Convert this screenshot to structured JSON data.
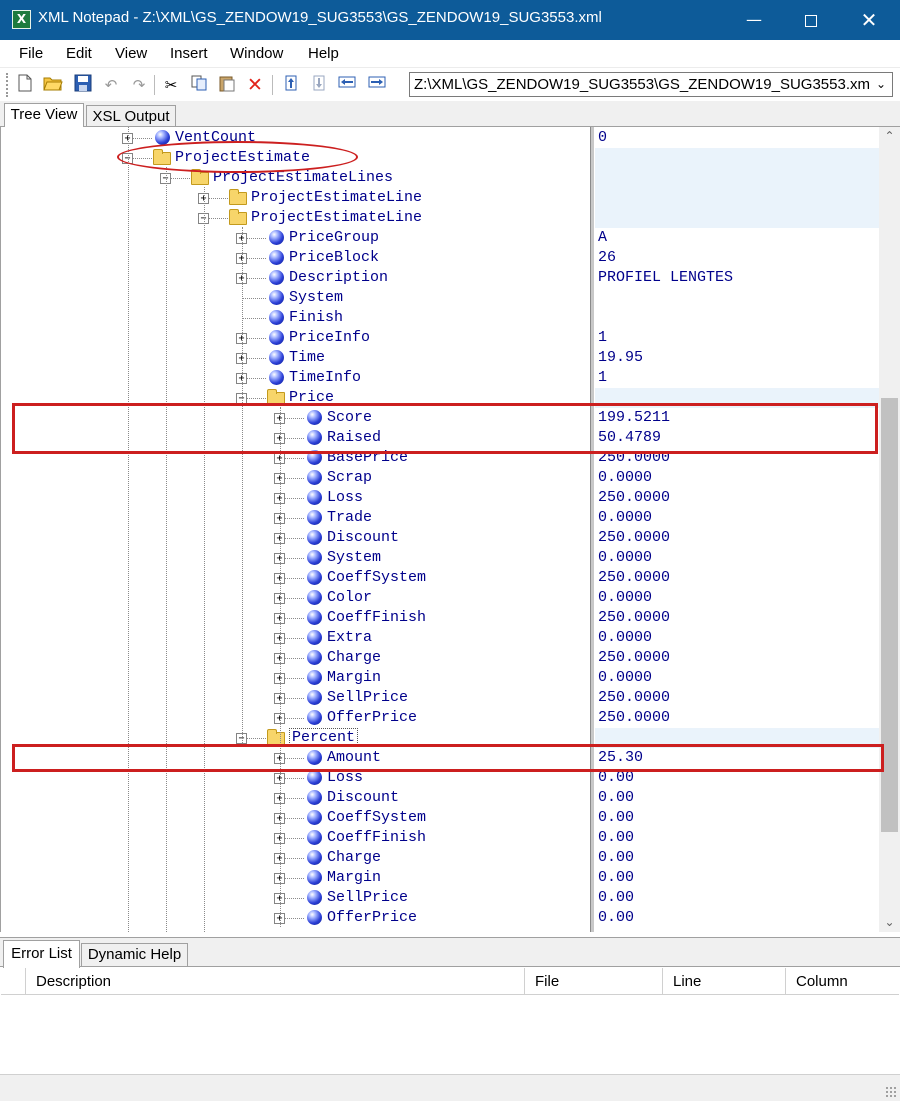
{
  "window": {
    "title": "XML Notepad - Z:\\XML\\GS_ZENDOW19_SUG3553\\GS_ZENDOW19_SUG3553.xml",
    "app_icon_letter": "X"
  },
  "menu": [
    "File",
    "Edit",
    "View",
    "Insert",
    "Window",
    "Help"
  ],
  "toolbar": {
    "icons": [
      "new-file-icon",
      "open-folder-icon",
      "save-icon",
      "undo-icon",
      "redo-icon",
      "cut-icon",
      "copy-icon",
      "paste-icon",
      "delete-icon",
      "nudge-up-icon",
      "nudge-down-icon",
      "nudge-left-icon",
      "nudge-right-icon"
    ],
    "path_value": "Z:\\XML\\GS_ZENDOW19_SUG3553\\GS_ZENDOW19_SUG3553.xml"
  },
  "tabs_top": [
    "Tree View",
    "XSL Output"
  ],
  "tree": [
    {
      "label": "VentCount",
      "value": "0"
    },
    {
      "label": "ProjectEstimate",
      "value": ""
    },
    {
      "label": "ProjectEstimateLines",
      "value": ""
    },
    {
      "label": "ProjectEstimateLine",
      "value": ""
    },
    {
      "label": "ProjectEstimateLine",
      "value": ""
    },
    {
      "label": "PriceGroup",
      "value": "A"
    },
    {
      "label": "PriceBlock",
      "value": "26"
    },
    {
      "label": "Description",
      "value": "PROFIEL LENGTES"
    },
    {
      "label": "System",
      "value": ""
    },
    {
      "label": "Finish",
      "value": ""
    },
    {
      "label": "PriceInfo",
      "value": "1"
    },
    {
      "label": "Time",
      "value": "19.95"
    },
    {
      "label": "TimeInfo",
      "value": "1"
    },
    {
      "label": "Price",
      "value": ""
    },
    {
      "label": "Score",
      "value": "199.5211"
    },
    {
      "label": "Raised",
      "value": "50.4789"
    },
    {
      "label": "BasePrice",
      "value": "250.0000"
    },
    {
      "label": "Scrap",
      "value": "0.0000"
    },
    {
      "label": "Loss",
      "value": "250.0000"
    },
    {
      "label": "Trade",
      "value": "0.0000"
    },
    {
      "label": "Discount",
      "value": "250.0000"
    },
    {
      "label": "System",
      "value": "0.0000"
    },
    {
      "label": "CoeffSystem",
      "value": "250.0000"
    },
    {
      "label": "Color",
      "value": "0.0000"
    },
    {
      "label": "CoeffFinish",
      "value": "250.0000"
    },
    {
      "label": "Extra",
      "value": "0.0000"
    },
    {
      "label": "Charge",
      "value": "250.0000"
    },
    {
      "label": "Margin",
      "value": "0.0000"
    },
    {
      "label": "SellPrice",
      "value": "250.0000"
    },
    {
      "label": "OfferPrice",
      "value": "250.0000"
    },
    {
      "label": "Percent",
      "value": ""
    },
    {
      "label": "Amount",
      "value": "25.30"
    },
    {
      "label": "Loss",
      "value": "0.00"
    },
    {
      "label": "Discount",
      "value": "0.00"
    },
    {
      "label": "CoeffSystem",
      "value": "0.00"
    },
    {
      "label": "CoeffFinish",
      "value": "0.00"
    },
    {
      "label": "Charge",
      "value": "0.00"
    },
    {
      "label": "Margin",
      "value": "0.00"
    },
    {
      "label": "SellPrice",
      "value": "0.00"
    },
    {
      "label": "OfferPrice",
      "value": "0.00"
    }
  ],
  "tabs_bottom": [
    "Error List",
    "Dynamic Help"
  ],
  "error_list": {
    "columns": [
      "Description",
      "File",
      "Line",
      "Column"
    ]
  },
  "colors": {
    "title_bar": "#0d5b99",
    "node_text": "#00008b",
    "annotation": "#cc1f1f",
    "value_highlight": "#eaf3fb"
  }
}
